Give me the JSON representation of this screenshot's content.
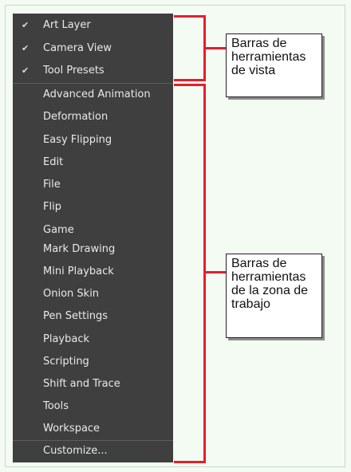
{
  "menu": {
    "view_toolbars": [
      {
        "label": "Art Layer",
        "checked": true
      },
      {
        "label": "Camera View",
        "checked": true
      },
      {
        "label": "Tool Presets",
        "checked": true
      }
    ],
    "workspace_toolbars": [
      {
        "label": "Advanced Animation"
      },
      {
        "label": "Deformation"
      },
      {
        "label": "Easy Flipping"
      },
      {
        "label": "Edit"
      },
      {
        "label": "File"
      },
      {
        "label": "Flip"
      },
      {
        "label": "Game"
      },
      {
        "label": "Mark Drawing"
      },
      {
        "label": "Mini Playback"
      },
      {
        "label": "Onion Skin"
      },
      {
        "label": "Pen Settings"
      },
      {
        "label": "Playback"
      },
      {
        "label": "Scripting"
      },
      {
        "label": "Shift and Trace"
      },
      {
        "label": "Tools"
      },
      {
        "label": "Workspace"
      }
    ],
    "customize_label": "Customize...",
    "check_glyph": "✔"
  },
  "callouts": {
    "view": [
      "Barras de",
      "herramientas",
      "de vista"
    ],
    "workspace": [
      "Barras de",
      "herramientas",
      "de la zona de",
      "trabajo"
    ]
  },
  "colors": {
    "menu_bg": "#3f3f3f",
    "menu_text": "#e9e9e9",
    "bracket": "#e3202a",
    "page_bg": "#f3fbf2"
  }
}
